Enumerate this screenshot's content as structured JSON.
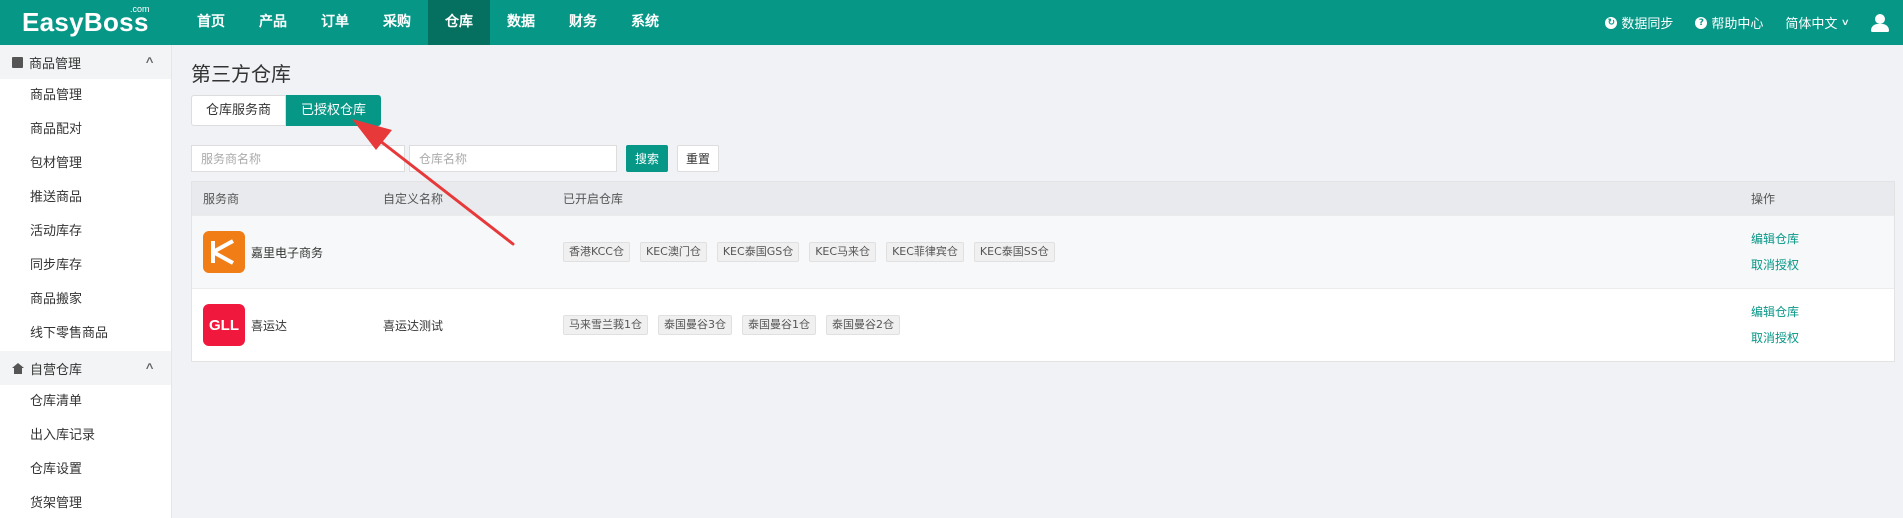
{
  "logo": {
    "text": "EasyBoss",
    "suffix": ".com"
  },
  "nav": [
    {
      "label": "首页"
    },
    {
      "label": "产品"
    },
    {
      "label": "订单"
    },
    {
      "label": "采购"
    },
    {
      "label": "仓库",
      "active": true
    },
    {
      "label": "数据"
    },
    {
      "label": "财务"
    },
    {
      "label": "系统"
    }
  ],
  "top_right": {
    "sync": "数据同步",
    "help": "帮助中心",
    "language": "简体中文"
  },
  "sidebar": {
    "groups": [
      {
        "label": "商品管理",
        "items": [
          "商品管理",
          "商品配对",
          "包材管理",
          "推送商品",
          "活动库存",
          "同步库存",
          "商品搬家",
          "线下零售商品"
        ]
      },
      {
        "label": "自营仓库",
        "items": [
          "仓库清单",
          "出入库记录",
          "仓库设置",
          "货架管理"
        ]
      }
    ]
  },
  "page_title": "第三方仓库",
  "tabs": [
    {
      "label": "仓库服务商"
    },
    {
      "label": "已授权仓库",
      "active": true
    }
  ],
  "filters": {
    "provider_placeholder": "服务商名称",
    "warehouse_placeholder": "仓库名称",
    "search": "搜索",
    "reset": "重置"
  },
  "table": {
    "headers": {
      "provider": "服务商",
      "custom_name": "自定义名称",
      "warehouses": "已开启仓库",
      "actions": "操作"
    },
    "rows": [
      {
        "logo": "K",
        "provider": "嘉里电子商务",
        "custom_name": "",
        "warehouses": [
          "香港KCC仓",
          "KEC澳门仓",
          "KEC泰国GS仓",
          "KEC马来仓",
          "KEC菲律宾仓",
          "KEC泰国SS仓"
        ],
        "edit": "编辑仓库",
        "revoke": "取消授权"
      },
      {
        "logo": "GLL",
        "provider": "喜运达",
        "custom_name": "喜运达测试",
        "warehouses": [
          "马来雪兰莪1仓",
          "泰国曼谷3仓",
          "泰国曼谷1仓",
          "泰国曼谷2仓"
        ],
        "edit": "编辑仓库",
        "revoke": "取消授权"
      }
    ]
  },
  "colors": {
    "primary": "#079787",
    "annotation_arrow": "#e8393a"
  }
}
